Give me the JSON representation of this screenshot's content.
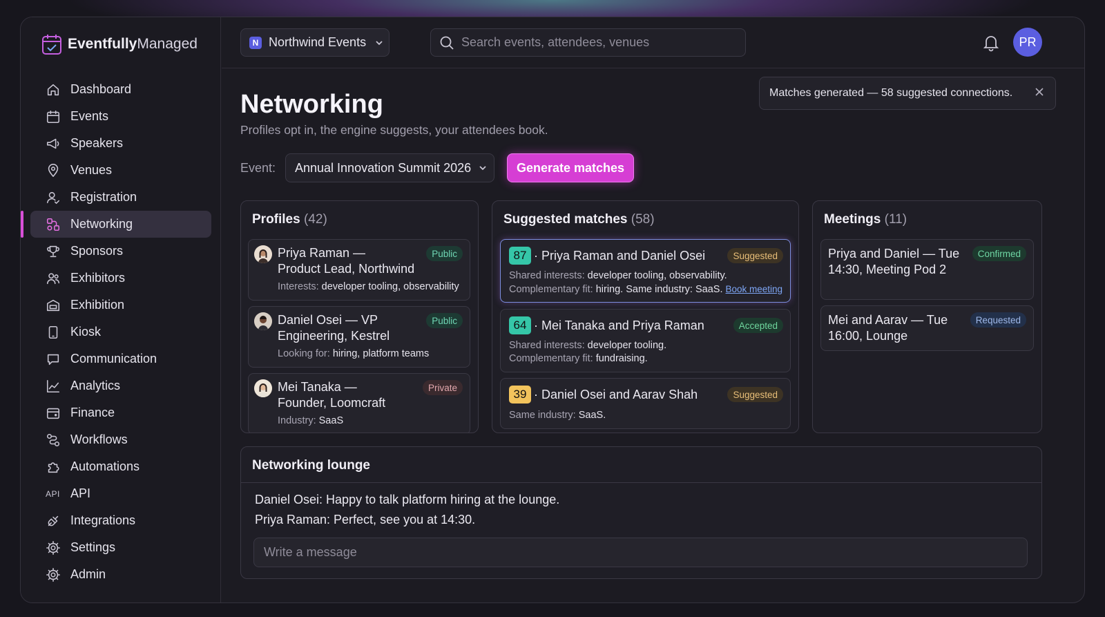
{
  "brand": {
    "bold": "Eventfully",
    "regular": "Managed"
  },
  "sidebar": {
    "items": [
      {
        "label": "Dashboard",
        "icon": "home-icon"
      },
      {
        "label": "Events",
        "icon": "calendar-icon"
      },
      {
        "label": "Speakers",
        "icon": "megaphone-icon"
      },
      {
        "label": "Venues",
        "icon": "map-pin-icon"
      },
      {
        "label": "Registration",
        "icon": "user-check-icon"
      },
      {
        "label": "Networking",
        "icon": "network-icon",
        "active": true
      },
      {
        "label": "Sponsors",
        "icon": "trophy-icon"
      },
      {
        "label": "Exhibitors",
        "icon": "users-icon"
      },
      {
        "label": "Exhibition",
        "icon": "building-icon"
      },
      {
        "label": "Kiosk",
        "icon": "tablet-icon"
      },
      {
        "label": "Communication",
        "icon": "message-icon"
      },
      {
        "label": "Analytics",
        "icon": "chart-line-icon"
      },
      {
        "label": "Finance",
        "icon": "wallet-icon"
      },
      {
        "label": "Workflows",
        "icon": "workflow-icon"
      },
      {
        "label": "Automations",
        "icon": "puzzle-icon"
      },
      {
        "label": "API",
        "icon": "api-icon",
        "icon_text": "API"
      },
      {
        "label": "Integrations",
        "icon": "plug-icon"
      },
      {
        "label": "Settings",
        "icon": "gear-icon"
      },
      {
        "label": "Admin",
        "icon": "gear-icon"
      }
    ]
  },
  "topbar": {
    "org_initial": "N",
    "org_name": "Northwind Events",
    "search_placeholder": "Search events, attendees, venues",
    "avatar_initials": "PR"
  },
  "toast": {
    "text": "Matches generated — 58 suggested connections."
  },
  "page": {
    "title": "Networking",
    "subtitle": "Profiles opt in, the engine suggests, your attendees book.",
    "event_label": "Event:",
    "event_value": "Annual Innovation Summit 2026",
    "generate_label": "Generate matches"
  },
  "profiles": {
    "title": "Profiles",
    "count": "(42)",
    "items": [
      {
        "line1": "Priya Raman —",
        "line2": "Product Lead, Northwind",
        "meta_label": "Interests:",
        "meta_value": "developer tooling, observability",
        "badge": "Public"
      },
      {
        "line1": "Daniel Osei — VP",
        "line2": "Engineering, Kestrel",
        "meta_label": "Looking for:",
        "meta_value": "hiring, platform teams",
        "badge": "Public"
      },
      {
        "line1": "Mei Tanaka —",
        "line2": "Founder, Loomcraft",
        "meta_label": "Industry:",
        "meta_value": "SaaS",
        "badge": "Private"
      }
    ]
  },
  "matches": {
    "title": "Suggested matches",
    "count": "(58)",
    "items": [
      {
        "score": "87",
        "pair": "· Priya Raman and Daniel Osei",
        "badge": "Suggested",
        "l1_label": "Shared interests:",
        "l1_value": "developer tooling, observability.",
        "l2_label": "Complementary fit:",
        "l2_value": "hiring. Same industry: SaaS.",
        "action": "Book meeting"
      },
      {
        "score": "64",
        "pair": "· Mei Tanaka and Priya Raman",
        "badge": "Accepted",
        "l1_label": "Shared interests:",
        "l1_value": "developer tooling.",
        "l2_label": "Complementary fit:",
        "l2_value": "fundraising."
      },
      {
        "score": "39",
        "pair": "· Daniel Osei and Aarav Shah",
        "badge": "Suggested",
        "l1_label": "Same industry:",
        "l1_value": "SaaS."
      }
    ]
  },
  "meetings": {
    "title": "Meetings",
    "count": "(11)",
    "items": [
      {
        "line1": "Priya and Daniel — Tue",
        "line2": "14:30, Meeting Pod 2",
        "badge": "Confirmed"
      },
      {
        "line1": "Mei and Aarav — Tue",
        "line2": "16:00, Lounge",
        "badge": "Requested"
      }
    ]
  },
  "lounge": {
    "title": "Networking lounge",
    "messages": [
      "Daniel Osei: Happy to talk platform hiring at the lounge.",
      "Priya Raman: Perfect, see you at 14:30."
    ],
    "input_placeholder": "Write a message"
  },
  "colors": {
    "accent": "#d63ed4",
    "avatar": "#5b5ee0",
    "score_high": "#35c6a8",
    "score_low": "#f2c35c"
  }
}
